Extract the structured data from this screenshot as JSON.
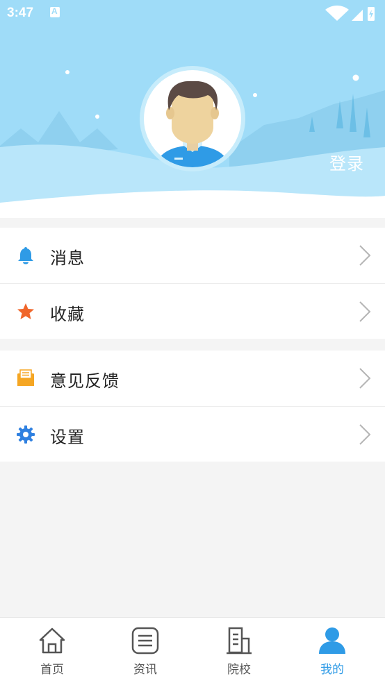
{
  "status_bar": {
    "time": "3:47"
  },
  "header": {
    "login_label": "登录"
  },
  "menu": {
    "group_a": [
      {
        "label": "消息",
        "icon": "bell-icon",
        "icon_color": "#2f9be6"
      },
      {
        "label": "收藏",
        "icon": "star-icon",
        "icon_color": "#f0662b"
      }
    ],
    "group_b": [
      {
        "label": "意见反馈",
        "icon": "envelope-icon",
        "icon_color": "#f5a623"
      },
      {
        "label": "设置",
        "icon": "gear-icon",
        "icon_color": "#2f80e0"
      }
    ]
  },
  "bottom_nav": {
    "items": [
      {
        "label": "首页",
        "icon": "home-icon",
        "active": false
      },
      {
        "label": "资讯",
        "icon": "news-icon",
        "active": false
      },
      {
        "label": "院校",
        "icon": "school-icon",
        "active": false
      },
      {
        "label": "我的",
        "icon": "profile-icon",
        "active": true
      }
    ],
    "active_color": "#2f9be6",
    "inactive_color": "#555555"
  }
}
